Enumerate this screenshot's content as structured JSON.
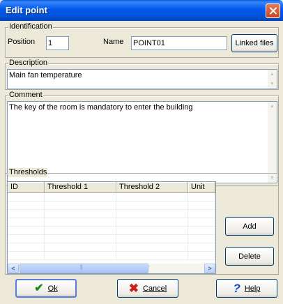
{
  "window": {
    "title": "Edit point"
  },
  "identification": {
    "group_label": "Identification",
    "position_label": "Position",
    "position_value": "1",
    "name_label": "Name",
    "name_value": "POINT01",
    "linked_files_label": "Linked files"
  },
  "description": {
    "group_label": "Description",
    "value": "Main fan temperature"
  },
  "comment": {
    "group_label": "Comment",
    "value": "The key of the room is mandatory to enter the building"
  },
  "thresholds": {
    "group_label": "Thresholds",
    "columns": [
      "ID",
      "Threshold 1",
      "Threshold 2",
      "Unit"
    ],
    "add_label": "Add",
    "delete_label": "Delete"
  },
  "footer": {
    "ok_label": "Ok",
    "cancel_label": "Cancel",
    "help_label": "Help"
  },
  "icons": {
    "ok": "checkmark-icon",
    "cancel": "x-icon",
    "help": "question-mark-icon",
    "close": "close-icon"
  },
  "colors": {
    "titlebar": "#0058ee",
    "dialog_bg": "#ece9d8",
    "close_button": "#d8562e"
  }
}
